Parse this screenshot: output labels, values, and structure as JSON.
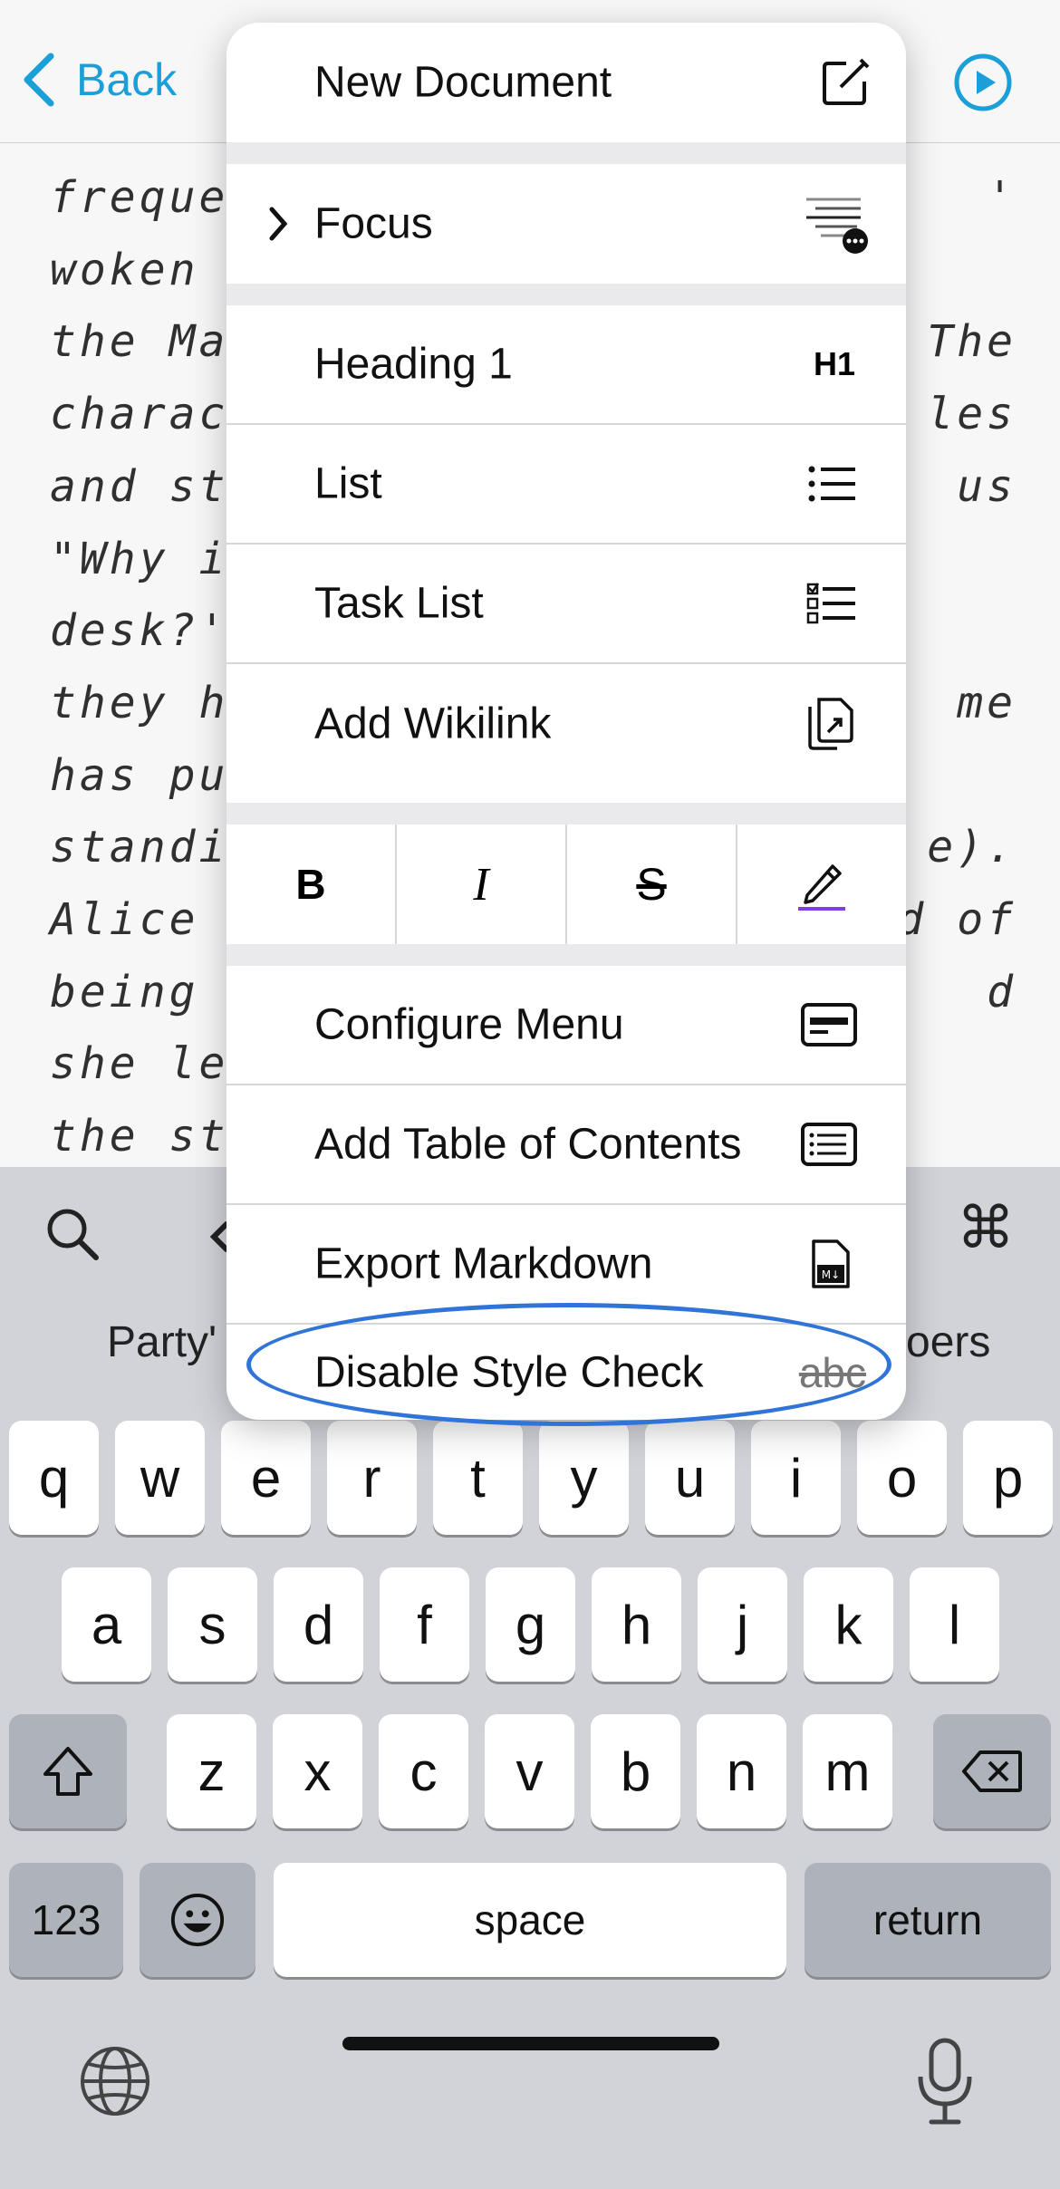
{
  "nav": {
    "back_label": "Back"
  },
  "editor": {
    "left_fragments": [
      "frequer",
      "woken",
      "the Ma",
      "charact",
      "and sto",
      "\"Why i",
      "desk?'.",
      "they ha",
      "has pur",
      "standir",
      "Alice b",
      "being b",
      "she lec",
      "the stu"
    ],
    "right_fragments": [
      {
        "text": "'",
        "row": 0
      },
      {
        "text": "The",
        "row": 2
      },
      {
        "text": "les",
        "row": 3
      },
      {
        "text": "us",
        "row": 4
      },
      {
        "text": "me",
        "row": 7
      },
      {
        "text": "e).",
        "row": 9
      },
      {
        "text": "d of",
        "row": 10
      },
      {
        "text": "d",
        "row": 11
      }
    ]
  },
  "menu": {
    "new_document": "New Document",
    "focus": "Focus",
    "heading": "Heading 1",
    "heading_icon": "H1",
    "list": "List",
    "task_list": "Task List",
    "add_wikilink": "Add Wikilink",
    "format_bold": "B",
    "format_italic": "I",
    "format_strike": "S",
    "configure_menu": "Configure Menu",
    "add_toc": "Add Table of Contents",
    "export_markdown": "Export Markdown",
    "disable_style_check": "Disable Style Check",
    "style_check_icon": "abc",
    "export_icon_text": "M↓"
  },
  "keyboard": {
    "suggestion_left": "Party'",
    "suggestion_right": "oers",
    "row1": [
      "q",
      "w",
      "e",
      "r",
      "t",
      "y",
      "u",
      "i",
      "o",
      "p"
    ],
    "row2": [
      "a",
      "s",
      "d",
      "f",
      "g",
      "h",
      "j",
      "k",
      "l"
    ],
    "row3": [
      "z",
      "x",
      "c",
      "v",
      "b",
      "n",
      "m"
    ],
    "num_key": "123",
    "space_key": "space",
    "return_key": "return",
    "cmd_glyph": "⌘"
  },
  "colors": {
    "accent": "#1a9fd8",
    "highlight_ring": "#2f74d6",
    "marker": "#7b3fe4"
  }
}
